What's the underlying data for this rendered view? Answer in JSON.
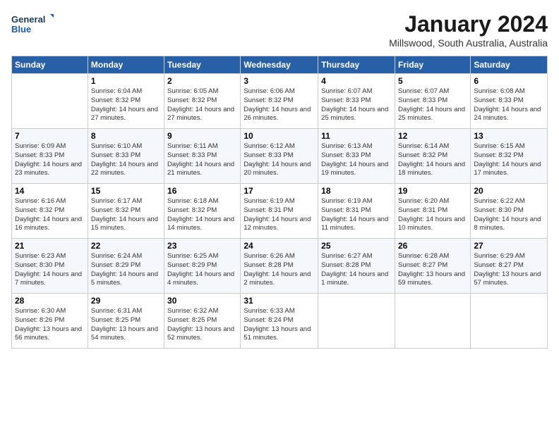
{
  "header": {
    "logo_line1": "General",
    "logo_line2": "Blue",
    "title": "January 2024",
    "location": "Millswood, South Australia, Australia"
  },
  "days_of_week": [
    "Sunday",
    "Monday",
    "Tuesday",
    "Wednesday",
    "Thursday",
    "Friday",
    "Saturday"
  ],
  "weeks": [
    [
      {
        "day": "",
        "info": ""
      },
      {
        "day": "1",
        "info": "Sunrise: 6:04 AM\nSunset: 8:32 PM\nDaylight: 14 hours\nand 27 minutes."
      },
      {
        "day": "2",
        "info": "Sunrise: 6:05 AM\nSunset: 8:32 PM\nDaylight: 14 hours\nand 27 minutes."
      },
      {
        "day": "3",
        "info": "Sunrise: 6:06 AM\nSunset: 8:32 PM\nDaylight: 14 hours\nand 26 minutes."
      },
      {
        "day": "4",
        "info": "Sunrise: 6:07 AM\nSunset: 8:33 PM\nDaylight: 14 hours\nand 25 minutes."
      },
      {
        "day": "5",
        "info": "Sunrise: 6:07 AM\nSunset: 8:33 PM\nDaylight: 14 hours\nand 25 minutes."
      },
      {
        "day": "6",
        "info": "Sunrise: 6:08 AM\nSunset: 8:33 PM\nDaylight: 14 hours\nand 24 minutes."
      }
    ],
    [
      {
        "day": "7",
        "info": "Sunrise: 6:09 AM\nSunset: 8:33 PM\nDaylight: 14 hours\nand 23 minutes."
      },
      {
        "day": "8",
        "info": "Sunrise: 6:10 AM\nSunset: 8:33 PM\nDaylight: 14 hours\nand 22 minutes."
      },
      {
        "day": "9",
        "info": "Sunrise: 6:11 AM\nSunset: 8:33 PM\nDaylight: 14 hours\nand 21 minutes."
      },
      {
        "day": "10",
        "info": "Sunrise: 6:12 AM\nSunset: 8:33 PM\nDaylight: 14 hours\nand 20 minutes."
      },
      {
        "day": "11",
        "info": "Sunrise: 6:13 AM\nSunset: 8:33 PM\nDaylight: 14 hours\nand 19 minutes."
      },
      {
        "day": "12",
        "info": "Sunrise: 6:14 AM\nSunset: 8:32 PM\nDaylight: 14 hours\nand 18 minutes."
      },
      {
        "day": "13",
        "info": "Sunrise: 6:15 AM\nSunset: 8:32 PM\nDaylight: 14 hours\nand 17 minutes."
      }
    ],
    [
      {
        "day": "14",
        "info": "Sunrise: 6:16 AM\nSunset: 8:32 PM\nDaylight: 14 hours\nand 16 minutes."
      },
      {
        "day": "15",
        "info": "Sunrise: 6:17 AM\nSunset: 8:32 PM\nDaylight: 14 hours\nand 15 minutes."
      },
      {
        "day": "16",
        "info": "Sunrise: 6:18 AM\nSunset: 8:32 PM\nDaylight: 14 hours\nand 14 minutes."
      },
      {
        "day": "17",
        "info": "Sunrise: 6:19 AM\nSunset: 8:31 PM\nDaylight: 14 hours\nand 12 minutes."
      },
      {
        "day": "18",
        "info": "Sunrise: 6:19 AM\nSunset: 8:31 PM\nDaylight: 14 hours\nand 11 minutes."
      },
      {
        "day": "19",
        "info": "Sunrise: 6:20 AM\nSunset: 8:31 PM\nDaylight: 14 hours\nand 10 minutes."
      },
      {
        "day": "20",
        "info": "Sunrise: 6:22 AM\nSunset: 8:30 PM\nDaylight: 14 hours\nand 8 minutes."
      }
    ],
    [
      {
        "day": "21",
        "info": "Sunrise: 6:23 AM\nSunset: 8:30 PM\nDaylight: 14 hours\nand 7 minutes."
      },
      {
        "day": "22",
        "info": "Sunrise: 6:24 AM\nSunset: 8:29 PM\nDaylight: 14 hours\nand 5 minutes."
      },
      {
        "day": "23",
        "info": "Sunrise: 6:25 AM\nSunset: 8:29 PM\nDaylight: 14 hours\nand 4 minutes."
      },
      {
        "day": "24",
        "info": "Sunrise: 6:26 AM\nSunset: 8:28 PM\nDaylight: 14 hours\nand 2 minutes."
      },
      {
        "day": "25",
        "info": "Sunrise: 6:27 AM\nSunset: 8:28 PM\nDaylight: 14 hours\nand 1 minute."
      },
      {
        "day": "26",
        "info": "Sunrise: 6:28 AM\nSunset: 8:27 PM\nDaylight: 13 hours\nand 59 minutes."
      },
      {
        "day": "27",
        "info": "Sunrise: 6:29 AM\nSunset: 8:27 PM\nDaylight: 13 hours\nand 57 minutes."
      }
    ],
    [
      {
        "day": "28",
        "info": "Sunrise: 6:30 AM\nSunset: 8:26 PM\nDaylight: 13 hours\nand 56 minutes."
      },
      {
        "day": "29",
        "info": "Sunrise: 6:31 AM\nSunset: 8:25 PM\nDaylight: 13 hours\nand 54 minutes."
      },
      {
        "day": "30",
        "info": "Sunrise: 6:32 AM\nSunset: 8:25 PM\nDaylight: 13 hours\nand 52 minutes."
      },
      {
        "day": "31",
        "info": "Sunrise: 6:33 AM\nSunset: 8:24 PM\nDaylight: 13 hours\nand 51 minutes."
      },
      {
        "day": "",
        "info": ""
      },
      {
        "day": "",
        "info": ""
      },
      {
        "day": "",
        "info": ""
      }
    ]
  ]
}
